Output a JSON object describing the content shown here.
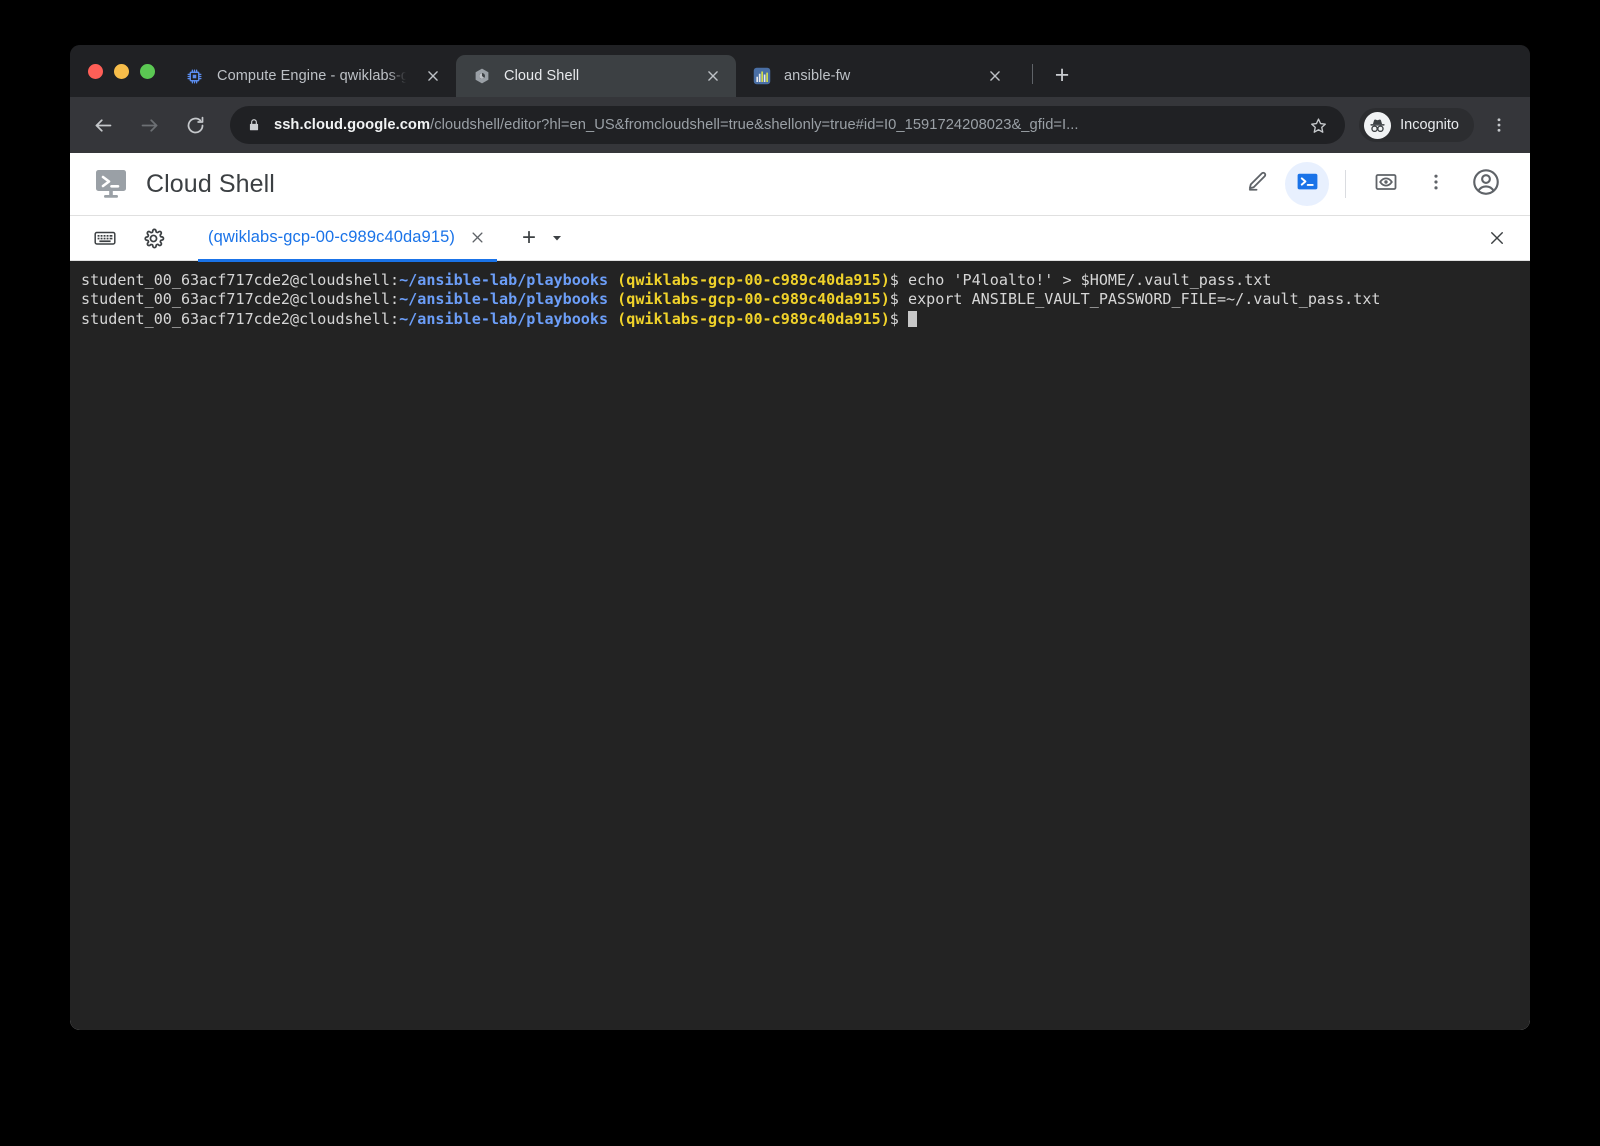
{
  "browser": {
    "tabs": [
      {
        "title": "Compute Engine - qwiklabs-gc",
        "favicon": "cpu-chip-icon",
        "active": false
      },
      {
        "title": "Cloud Shell",
        "favicon": "cloud-shell-hex-icon",
        "active": true
      },
      {
        "title": "ansible-fw",
        "favicon": "chart-bars-icon",
        "active": false
      }
    ],
    "new_tab_label": "+",
    "toolbar": {
      "back_icon": "arrow-left-icon",
      "forward_icon": "arrow-right-icon",
      "reload_icon": "reload-icon",
      "lock_icon": "lock-icon",
      "url_host": "ssh.cloud.google.com",
      "url_path": "/cloudshell/editor?hl=en_US&fromcloudshell=true&shellonly=true#id=I0_1591724208023&_gfid=I...",
      "star_icon": "star-outline-icon",
      "incognito_label": "Incognito",
      "incognito_icon": "incognito-hat-glasses-icon",
      "menu_icon": "three-dots-vertical-icon"
    }
  },
  "cloudshell": {
    "logo_icon": "cloud-shell-terminal-icon",
    "title": "Cloud Shell",
    "tools": [
      {
        "name": "open-editor-button",
        "icon": "pencil-icon",
        "active": false
      },
      {
        "name": "open-terminal-button",
        "icon": "terminal-prompt-icon",
        "active": true
      },
      {
        "name": "web-preview-button",
        "icon": "web-preview-icon",
        "active": false
      },
      {
        "name": "more-options-button",
        "icon": "three-dots-vertical-icon",
        "active": false
      },
      {
        "name": "account-button",
        "icon": "account-circle-icon",
        "active": false
      }
    ],
    "tabbar": {
      "keyboard_icon": "keyboard-icon",
      "settings_icon": "gear-icon",
      "session_label": "(qwiklabs-gcp-00-c989c40da915)",
      "session_close_icon": "close-icon",
      "add_tab_label": "+",
      "add_tab_caret_icon": "chevron-down-icon",
      "close_panel_icon": "close-icon"
    }
  },
  "terminal": {
    "prompt": {
      "user": "student_00_63acf717cde2@cloudshell:",
      "path": "~/ansible-lab/playbooks",
      "project": " (qwiklabs-gcp-00-c989c40da915)",
      "dollar": "$ "
    },
    "lines": [
      {
        "command": "echo 'P4loalto!' > $HOME/.vault_pass.txt",
        "cursor": false
      },
      {
        "command": "export ANSIBLE_VAULT_PASSWORD_FILE=~/.vault_pass.txt",
        "cursor": false
      },
      {
        "command": "",
        "cursor": true
      }
    ]
  },
  "colors": {
    "accent_blue": "#1a73e8",
    "terminal_bg": "#232323",
    "prompt_path": "#6c9ef8",
    "prompt_project": "#f0d22a",
    "browser_chrome": "#202124"
  }
}
